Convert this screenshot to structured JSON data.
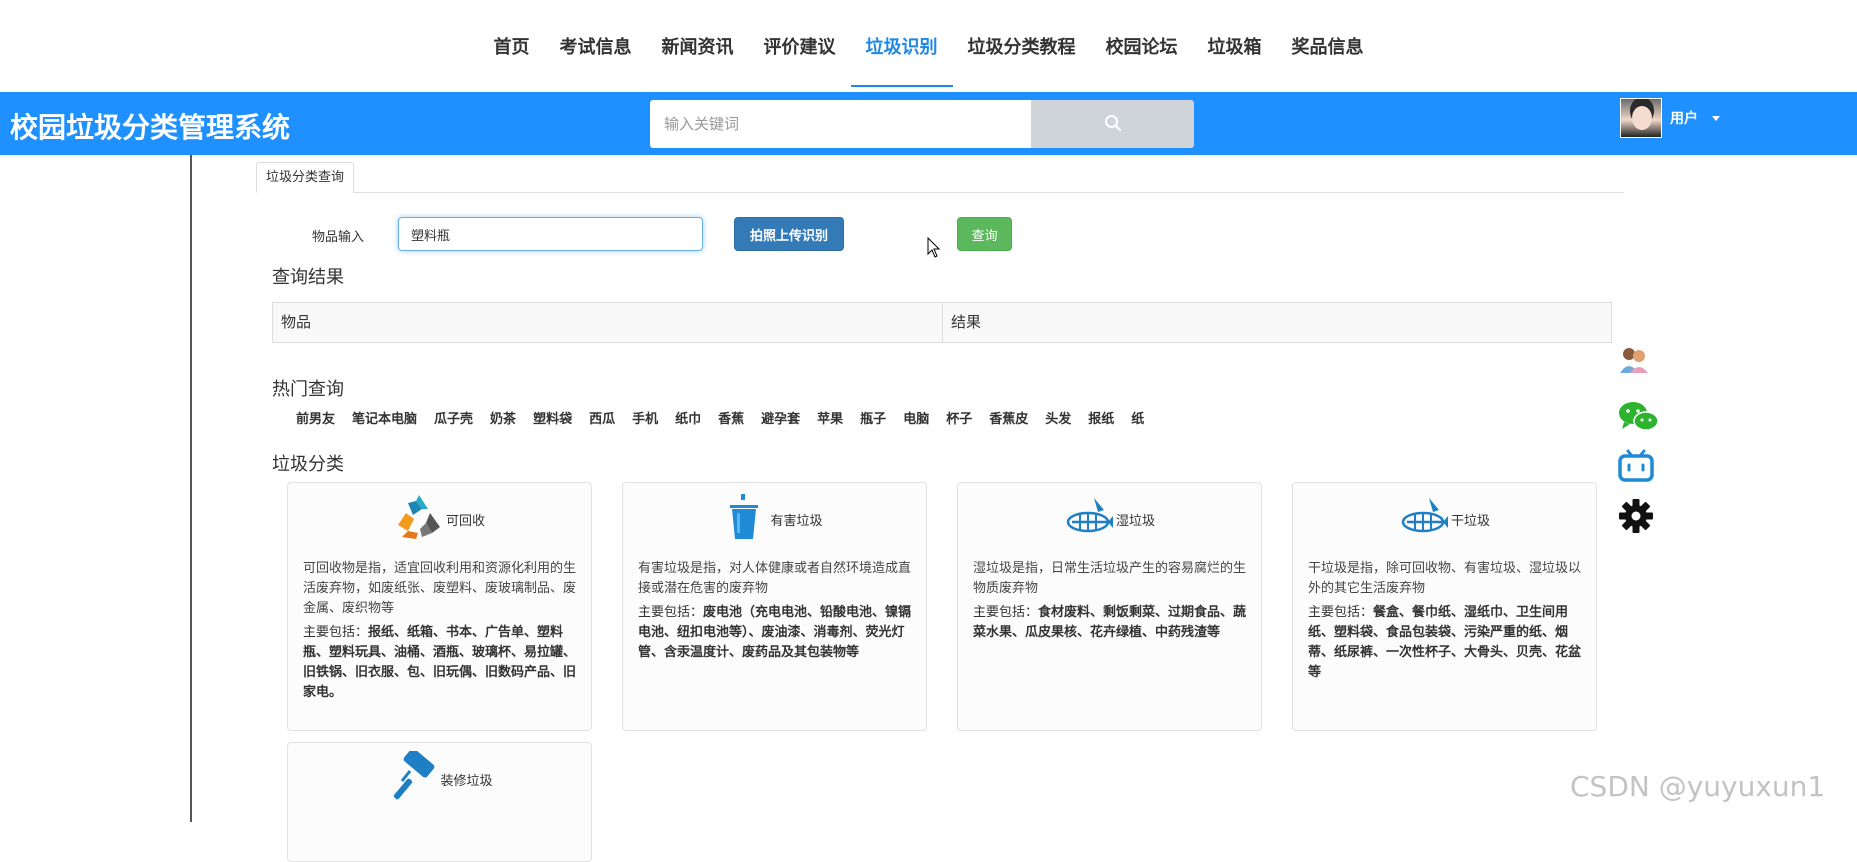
{
  "nav": {
    "items": [
      {
        "label": "首页"
      },
      {
        "label": "考试信息"
      },
      {
        "label": "新闻资讯"
      },
      {
        "label": "评价建议"
      },
      {
        "label": "垃圾识别",
        "active": true
      },
      {
        "label": "垃圾分类教程"
      },
      {
        "label": "校园论坛"
      },
      {
        "label": "垃圾箱"
      },
      {
        "label": "奖品信息"
      }
    ]
  },
  "header": {
    "title": "校园垃圾分类管理系统",
    "search_placeholder": "输入关键词",
    "search_icon": "search-icon",
    "user_name": "用户",
    "accent_color": "#1e90ff"
  },
  "tab": {
    "label": "垃圾分类查询"
  },
  "form": {
    "item_label": "物品输入",
    "item_value": "塑料瓶",
    "upload_button": "拍照上传识别",
    "query_button": "查询"
  },
  "results": {
    "title": "查询结果",
    "columns": [
      "物品",
      "结果"
    ]
  },
  "hot": {
    "title": "热门查询",
    "items": [
      "前男友",
      "笔记本电脑",
      "瓜子壳",
      "奶茶",
      "塑料袋",
      "西瓜",
      "手机",
      "纸巾",
      "香蕉",
      "避孕套",
      "苹果",
      "瓶子",
      "电脑",
      "杯子",
      "香蕉皮",
      "头发",
      "报纸",
      "纸"
    ]
  },
  "categories": {
    "title": "垃圾分类",
    "cards": [
      {
        "name": "可回收",
        "icon": "recycle-icon",
        "desc": "可回收物是指，适宜回收利用和资源化利用的生活废弃物，如废纸张、废塑料、废玻璃制品、废金属、废织物等",
        "includes_label": "主要包括：",
        "includes": "报纸、纸箱、书本、广告单、塑料瓶、塑料玩具、油桶、酒瓶、玻璃杯、易拉罐、旧铁锅、旧衣服、包、旧玩偶、旧数码产品、旧家电。"
      },
      {
        "name": "有害垃圾",
        "icon": "hazardous-bin-icon",
        "desc": "有害垃圾是指，对人体健康或者自然环境造成直接或潜在危害的废弃物",
        "includes_label": "主要包括：",
        "includes": "废电池（充电电池、铅酸电池、镍镉电池、纽扣电池等）、废油漆、消毒剂、荧光灯管、含汞温度计、废药品及其包装物等"
      },
      {
        "name": "湿垃圾",
        "icon": "fish-bone-icon",
        "desc": "湿垃圾是指，日常生活垃圾产生的容易腐烂的生物质废弃物",
        "includes_label": "主要包括：",
        "includes": "食材废料、剩饭剩菜、过期食品、蔬菜水果、瓜皮果核、花卉绿植、中药残渣等"
      },
      {
        "name": "干垃圾",
        "icon": "fish-bone-icon",
        "desc": "干垃圾是指，除可回收物、有害垃圾、湿垃圾以外的其它生活废弃物",
        "includes_label": "主要包括：",
        "includes": "餐盒、餐巾纸、湿纸巾、卫生间用纸、塑料袋、食品包装袋、污染严重的纸、烟蒂、纸尿裤、一次性杯子、大骨头、贝壳、花盆等"
      },
      {
        "name": "装修垃圾",
        "icon": "paint-roller-icon"
      }
    ]
  },
  "side_icons": [
    "chat-users-icon",
    "wechat-icon",
    "bilibili-icon",
    "settings-gear-icon"
  ],
  "watermark": "CSDN @yuyuxun1"
}
